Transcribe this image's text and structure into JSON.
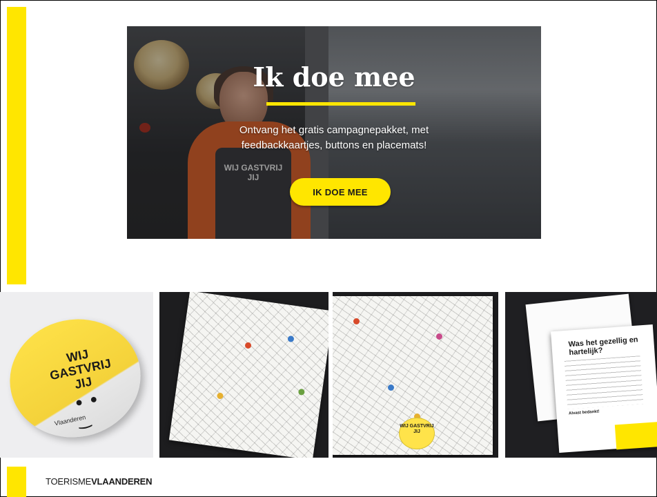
{
  "hero": {
    "title": "Ik doe mee",
    "subtitle": "Ontvang het gratis campagnepakket, met feedbackkaartjes, buttons en placemats!",
    "cta_label": "IK DOE MEE",
    "apron_text": "WIJ GASTVRIJ JIJ"
  },
  "photos": {
    "badge_text": "WIJ GASTVRIJ JIJ",
    "badge_brand": "Vlaanderen",
    "placemat_badge_text": "WIJ GASTVRIJ JIJ",
    "card_title": "Was het gezellig en hartelijk?",
    "card_thanks": "Alvast bedankt!"
  },
  "footer": {
    "brand_light": "TOERISME",
    "brand_bold": "VLAANDEREN"
  },
  "colors": {
    "accent_yellow": "#ffe600",
    "text_dark": "#1a1a1a"
  }
}
